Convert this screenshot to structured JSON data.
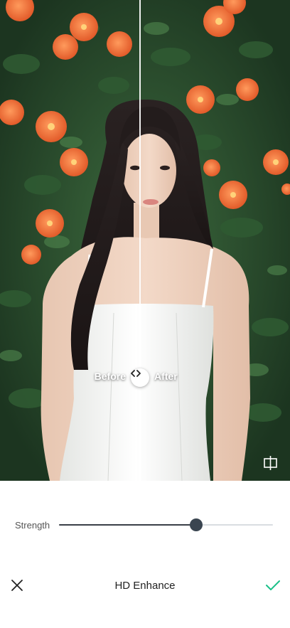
{
  "compare": {
    "before_label": "Before",
    "after_label": "After",
    "handle_icon": "swap-horizontal-icon"
  },
  "crop_icon": "crop-icon",
  "strength": {
    "label": "Strength",
    "value_fraction": 0.64
  },
  "bottom_bar": {
    "title": "HD Enhance",
    "close_icon": "close-icon",
    "confirm_icon": "checkmark-icon"
  },
  "colors": {
    "accent": "#1bc089",
    "flower": "#f0703c",
    "foliage": "#264a2c",
    "slider_thumb": "#3a4550"
  }
}
